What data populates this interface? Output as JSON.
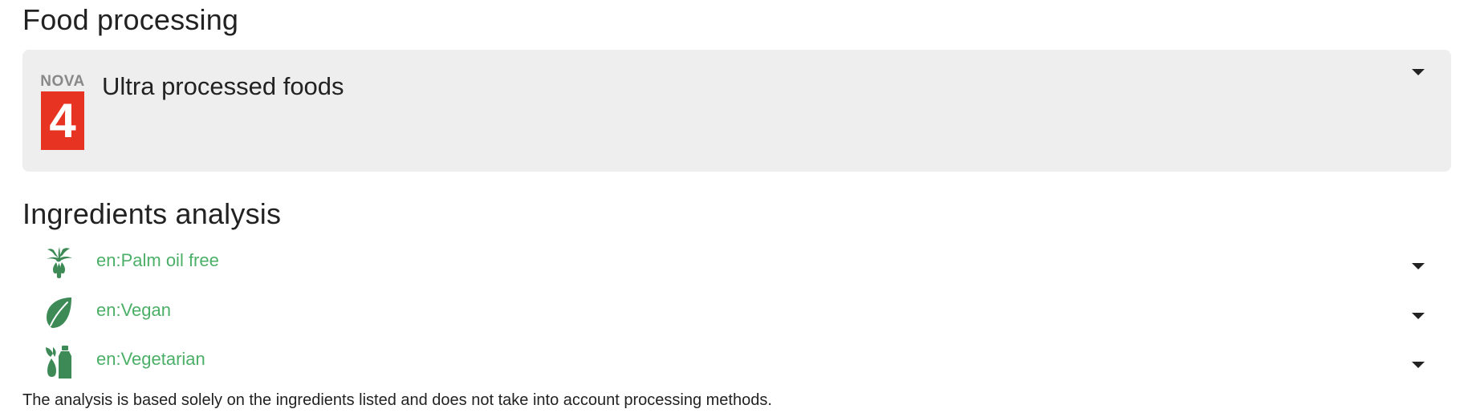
{
  "food_processing": {
    "title": "Food processing",
    "nova": {
      "badge_word": "NOVA",
      "group": "4",
      "label": "Ultra processed foods",
      "badge_color": "#e63322"
    }
  },
  "ingredients_analysis": {
    "title": "Ingredients analysis",
    "items": [
      {
        "label": "en:Palm oil free",
        "icon": "palm-tree-icon"
      },
      {
        "label": "en:Vegan",
        "icon": "leaf-icon"
      },
      {
        "label": "en:Vegetarian",
        "icon": "milk-egg-icon"
      }
    ],
    "item_color": "#4caf67",
    "note": "The analysis is based solely on the ingredients listed and does not take into account processing methods."
  },
  "colors": {
    "panel_bg": "#eeeeee",
    "icon_green": "#3d8a57"
  }
}
